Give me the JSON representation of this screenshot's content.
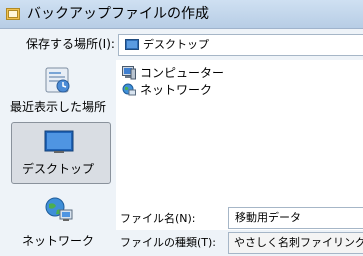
{
  "window": {
    "title": "バックアップファイルの作成"
  },
  "save_in": {
    "label": "保存する場所(I):",
    "value": "デスクトップ"
  },
  "places": [
    {
      "label": "最近表示した場所",
      "icon": "recent-places-icon",
      "selected": false
    },
    {
      "label": "デスクトップ",
      "icon": "desktop-icon",
      "selected": true
    },
    {
      "label": "ネットワーク",
      "icon": "network-icon",
      "selected": false
    }
  ],
  "files": [
    {
      "name": "コンピューター",
      "icon": "computer-icon"
    },
    {
      "name": "ネットワーク",
      "icon": "network-icon"
    }
  ],
  "file_name": {
    "label": "ファイル名(N):",
    "value": "移動用データ"
  },
  "file_type": {
    "label": "ファイルの種類(T):",
    "value": "やさしく名刺ファイリング バック"
  }
}
